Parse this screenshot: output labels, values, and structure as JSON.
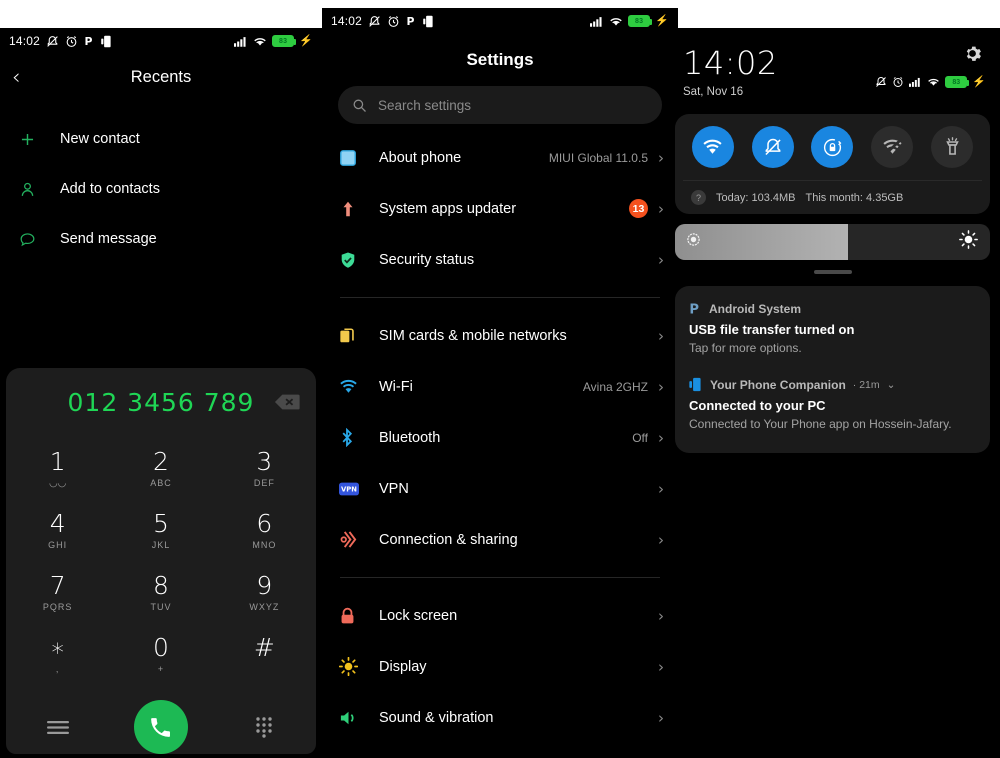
{
  "statusbar": {
    "time": "14:02",
    "battery_level": "83",
    "icons": [
      "silent-icon",
      "alarm-icon",
      "p-app-icon",
      "phone-link-icon"
    ],
    "right_icons": [
      "signal-icon",
      "wifi-icon",
      "battery-icon",
      "charging-bolt-icon"
    ]
  },
  "left_panel": {
    "title": "Recents",
    "back_label": "‹",
    "items": [
      {
        "icon": "plus-icon",
        "label": "New contact"
      },
      {
        "icon": "person-icon",
        "label": "Add to contacts"
      },
      {
        "icon": "message-icon",
        "label": "Send message"
      }
    ],
    "dialer": {
      "number": "012 3456 789",
      "keys": [
        {
          "num": "1",
          "sub": "◡◡"
        },
        {
          "num": "2",
          "sub": "ABC"
        },
        {
          "num": "3",
          "sub": "DEF"
        },
        {
          "num": "4",
          "sub": "GHI"
        },
        {
          "num": "5",
          "sub": "JKL"
        },
        {
          "num": "6",
          "sub": "MNO"
        },
        {
          "num": "7",
          "sub": "PQRS"
        },
        {
          "num": "8",
          "sub": "TUV"
        },
        {
          "num": "9",
          "sub": "WXYZ"
        },
        {
          "num": "∗",
          "sub": ","
        },
        {
          "num": "0",
          "sub": "+"
        },
        {
          "num": "#",
          "sub": ""
        }
      ],
      "actions": {
        "menu": "menu-icon",
        "call": "call-icon",
        "keypad": "keypad-icon",
        "backspace": "backspace-icon"
      }
    }
  },
  "mid_panel": {
    "title": "Settings",
    "search": {
      "placeholder": "Search settings",
      "value": "",
      "icon": "search-icon"
    },
    "groups": [
      {
        "rows": [
          {
            "icon": "about-phone-icon",
            "label": "About phone",
            "value": "MIUI Global 11.0.5",
            "badge": ""
          },
          {
            "icon": "system-update-icon",
            "label": "System apps updater",
            "value": "",
            "badge": "13"
          },
          {
            "icon": "security-shield-icon",
            "label": "Security status",
            "value": "",
            "badge": ""
          }
        ]
      },
      {
        "rows": [
          {
            "icon": "sim-card-icon",
            "label": "SIM cards & mobile networks",
            "value": "",
            "badge": ""
          },
          {
            "icon": "wifi-icon",
            "label": "Wi-Fi",
            "value": "Avina 2GHZ",
            "badge": ""
          },
          {
            "icon": "bluetooth-icon",
            "label": "Bluetooth",
            "value": "Off",
            "badge": ""
          },
          {
            "icon": "vpn-icon",
            "label": "VPN",
            "value": "",
            "badge": ""
          },
          {
            "icon": "connection-sharing-icon",
            "label": "Connection & sharing",
            "value": "",
            "badge": ""
          }
        ]
      },
      {
        "rows": [
          {
            "icon": "lock-screen-icon",
            "label": "Lock screen",
            "value": "",
            "badge": ""
          },
          {
            "icon": "display-icon",
            "label": "Display",
            "value": "",
            "badge": ""
          },
          {
            "icon": "sound-icon",
            "label": "Sound & vibration",
            "value": "",
            "badge": ""
          }
        ]
      }
    ],
    "chevron": "›"
  },
  "right_panel": {
    "clock": "14:02",
    "date": "Sat, Nov 16",
    "settings_icon": "gear-icon",
    "toggles": [
      {
        "name": "wifi-toggle",
        "state": "on"
      },
      {
        "name": "silent-toggle",
        "state": "on"
      },
      {
        "name": "auto-rotate-lock-toggle",
        "state": "on"
      },
      {
        "name": "hotspot-toggle",
        "state": "off"
      },
      {
        "name": "flashlight-toggle",
        "state": "off"
      }
    ],
    "data_usage": {
      "today": "Today: 103.4MB",
      "month": "This month: 4.35GB",
      "help": "?"
    },
    "brightness": {
      "percent": "55"
    },
    "notifications": [
      {
        "app": "Android System",
        "app_icon": "p-app-icon",
        "time": "",
        "title": "USB file transfer turned on",
        "text": "Tap for more options."
      },
      {
        "app": "Your Phone Companion",
        "app_icon": "phone-link-icon",
        "time": "· 21m",
        "title": "Connected to your PC",
        "text": "Connected to Your Phone app on Hossein-Jafary."
      }
    ]
  }
}
